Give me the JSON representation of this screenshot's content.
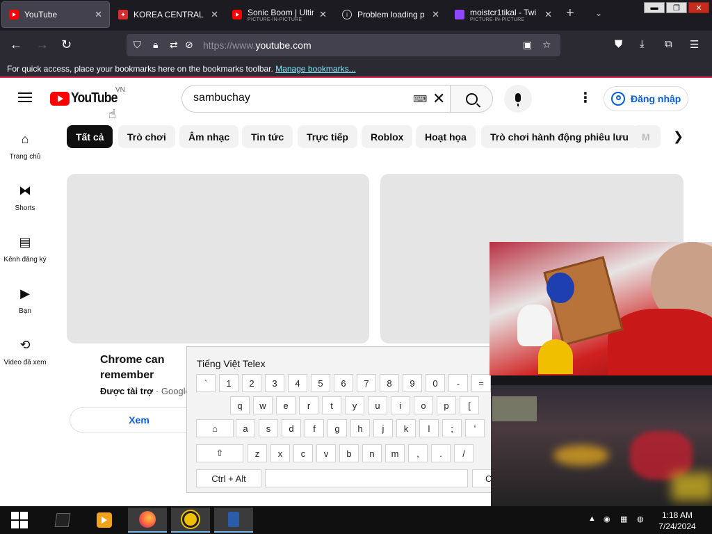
{
  "browser": {
    "tabs": [
      {
        "title": "YouTube",
        "sub": ""
      },
      {
        "title": "KOREA CENTRAL T",
        "sub": ""
      },
      {
        "title": "Sonic Boom | Ultim",
        "sub": "PICTURE-IN-PICTURE"
      },
      {
        "title": "Problem loading p",
        "sub": ""
      },
      {
        "title": "moistcr1tikal - Twi",
        "sub": "PICTURE-IN-PICTURE"
      }
    ],
    "url_scheme": "https://www.",
    "url_host": "youtube.com",
    "bookmarks_text": "For quick access, place your bookmarks here on the bookmarks toolbar.",
    "bookmarks_link": "Manage bookmarks..."
  },
  "youtube": {
    "logo_text": "YouTube",
    "country": "VN",
    "search_value": "sambuchay",
    "sign_in": "Đăng nhập",
    "guide": [
      {
        "label": "Trang chủ"
      },
      {
        "label": "Shorts"
      },
      {
        "label": "Kênh đăng ký"
      },
      {
        "label": "Bạn"
      },
      {
        "label": "Video đã xem"
      }
    ],
    "chips": [
      "Tất cả",
      "Trò chơi",
      "Âm nhạc",
      "Tin tức",
      "Trực tiếp",
      "Roblox",
      "Hoạt họa",
      "Trò chơi hành động phiêu lưu",
      "M"
    ],
    "ad": {
      "title": "Chrome can remember passwords so you don't have to.",
      "sponsored": "Được tài trợ",
      "advertiser": " · Google",
      "button": "Xem"
    }
  },
  "keyboard": {
    "title": "Tiếng Việt Telex",
    "row1": [
      "`",
      "1",
      "2",
      "3",
      "4",
      "5",
      "6",
      "7",
      "8",
      "9",
      "0",
      "-",
      "="
    ],
    "row2": [
      "q",
      "w",
      "e",
      "r",
      "t",
      "y",
      "u",
      "i",
      "o",
      "p",
      "["
    ],
    "row3": [
      "a",
      "s",
      "d",
      "f",
      "g",
      "h",
      "j",
      "k",
      "l",
      ";",
      "'"
    ],
    "row4": [
      "z",
      "x",
      "c",
      "v",
      "b",
      "n",
      "m",
      ",",
      ".",
      "/"
    ],
    "ctrl_alt": "Ctrl + Alt",
    "right_partial": "C"
  },
  "taskbar": {
    "time": "1:18 AM",
    "date": "7/24/2024"
  }
}
